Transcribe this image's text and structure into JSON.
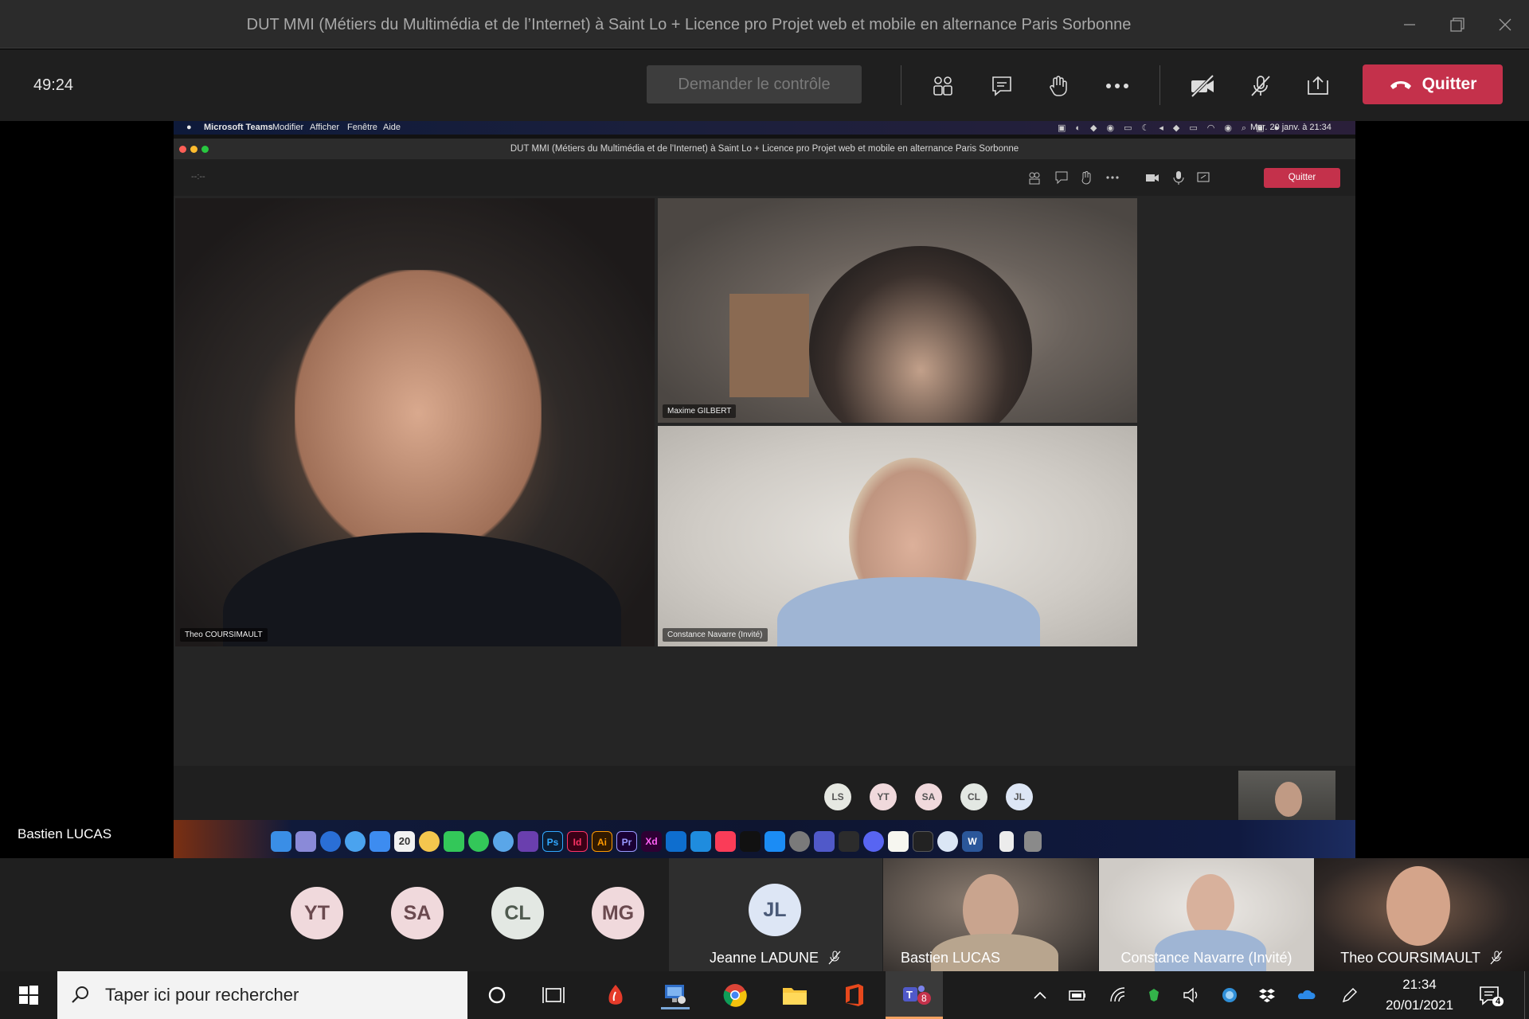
{
  "window": {
    "title": "DUT MMI (Métiers du Multimédia et de l’Internet) à Saint Lo + Licence pro Projet web et mobile en alternance Paris Sorbonne"
  },
  "meeting_toolbar": {
    "timer": "49:24",
    "request_control": "Demander le contrôle",
    "quit": "Quitter"
  },
  "shared_screen": {
    "mac_menu": {
      "app": "Microsoft Teams",
      "items": [
        "Modifier",
        "Afficher",
        "Fenêtre",
        "Aide"
      ],
      "datetime": "Mer. 20 janv. à 21:34"
    },
    "window_title": "DUT MMI (Métiers du Multimédia et de l'Internet) à Saint Lo + Licence pro Projet web et mobile en alternance Paris Sorbonne",
    "timer": "--:--",
    "quit": "Quitter",
    "tiles": [
      {
        "name": "Theo COURSIMAULT"
      },
      {
        "name": "Maxime GILBERT"
      },
      {
        "name": "Constance Navarre (Invité)"
      }
    ],
    "avatars": [
      "LS",
      "YT",
      "SA",
      "CL",
      "JL"
    ],
    "dock": [
      "Ps",
      "Id",
      "Ai",
      "Pr",
      "Xd",
      "W"
    ]
  },
  "presenter": "Bastien LUCAS",
  "participants": {
    "avatars": [
      "YT",
      "SA",
      "CL",
      "MG"
    ],
    "tiles": [
      {
        "name": "Jeanne LADUNE",
        "initials": "JL",
        "muted": true
      },
      {
        "name": "Bastien LUCAS",
        "muted": false
      },
      {
        "name": "Constance Navarre (Invité)",
        "muted": false
      },
      {
        "name": "Theo COURSIMAULT",
        "muted": true
      }
    ]
  },
  "taskbar": {
    "search_placeholder": "Taper ici pour rechercher",
    "time": "21:34",
    "date": "20/01/2021",
    "teams_badge": "8",
    "notifications_badge": "4"
  },
  "colors": {
    "accent_red": "#c4314b",
    "avatar_pink": "#f0d9dc",
    "avatar_green": "#e3e8e3",
    "avatar_blue": "#dde6f5"
  }
}
